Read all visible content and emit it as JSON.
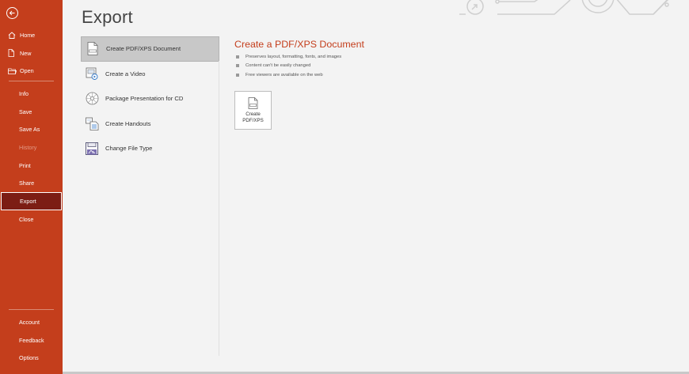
{
  "colors": {
    "accent": "#c43e1c",
    "selected_nav": "#7c1d14"
  },
  "sidebar": {
    "top_items": [
      {
        "label": "Home",
        "icon": "home-icon"
      },
      {
        "label": "New",
        "icon": "new-document-icon"
      },
      {
        "label": "Open",
        "icon": "folder-icon"
      }
    ],
    "middle_items": [
      {
        "label": "Info"
      },
      {
        "label": "Save"
      },
      {
        "label": "Save As"
      },
      {
        "label": "History",
        "disabled": true
      },
      {
        "label": "Print"
      },
      {
        "label": "Share"
      },
      {
        "label": "Export",
        "selected": true
      },
      {
        "label": "Close"
      }
    ],
    "bottom_items": [
      {
        "label": "Account"
      },
      {
        "label": "Feedback"
      },
      {
        "label": "Options"
      }
    ]
  },
  "page": {
    "title": "Export"
  },
  "export_options": [
    {
      "label": "Create PDF/XPS Document",
      "icon": "pdf-document-icon",
      "selected": true
    },
    {
      "label": "Create a Video",
      "icon": "video-icon"
    },
    {
      "label": "Package Presentation for CD",
      "icon": "cd-icon"
    },
    {
      "label": "Create Handouts",
      "icon": "handouts-icon"
    },
    {
      "label": "Change File Type",
      "icon": "save-file-icon"
    }
  ],
  "detail": {
    "title": "Create a PDF/XPS Document",
    "bullets": [
      "Preserves layout, formatting, fonts, and images",
      "Content can't be easily changed",
      "Free viewers are available on the web"
    ],
    "button": {
      "label_line1": "Create",
      "label_line2": "PDF/XPS",
      "icon": "pdf-xps-icon"
    }
  }
}
